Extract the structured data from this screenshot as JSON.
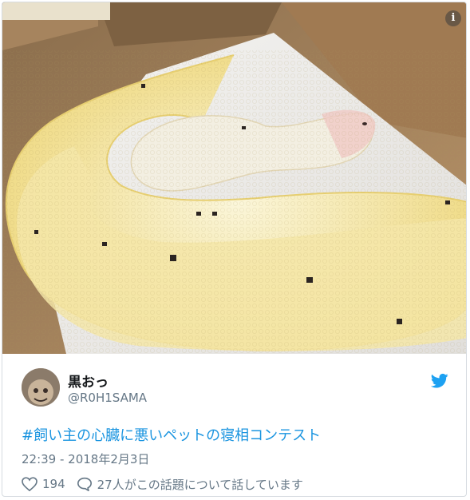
{
  "tweet": {
    "display_name": "黒おっ",
    "handle": "@R0H1SAMA",
    "hashtag_text": "#飼い主の心臓に悪いペットの寝相コンテスト",
    "timestamp": "22:39 - 2018年2月3日",
    "like_count": "194",
    "reply_text": "27人がこの話題について話しています",
    "info_glyph": "i"
  },
  "icons": {
    "like": "heart-icon",
    "reply": "speech-bubble-icon",
    "brand": "twitter-bird-icon",
    "info": "info-icon"
  },
  "colors": {
    "link": "#1b95e0",
    "muted": "#657786",
    "brand": "#1da1f2",
    "text": "#14171a"
  }
}
